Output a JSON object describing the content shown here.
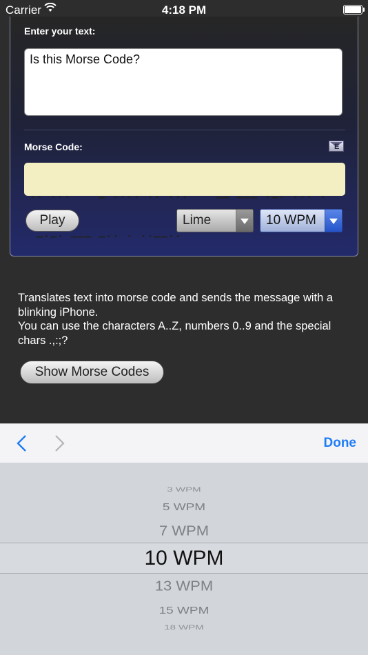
{
  "status_bar": {
    "carrier": "Carrier",
    "time": "4:18 PM"
  },
  "input_section": {
    "label": "Enter your text:",
    "value": "Is this Morse Code?"
  },
  "morse_section": {
    "label": "Morse Code:",
    "mail_icon_letter": "E",
    "code_line1": "·· ···    – ···· ·· ···    –– ––– ·–· ··· ·",
    "code_line2": " –·–· ––– –·· · ··––··"
  },
  "controls": {
    "play_label": "Play",
    "color_select": "Lime",
    "speed_select": "10 WPM"
  },
  "description": {
    "line1": "Translates text into morse code and sends the message with a blinking iPhone.",
    "line2": "You can use the characters A..Z, numbers 0..9 and the special chars .,:;?"
  },
  "show_codes_label": "Show Morse Codes",
  "toolbar": {
    "done_label": "Done"
  },
  "picker": {
    "options": [
      "3 WPM",
      "5 WPM",
      "7 WPM",
      "10 WPM",
      "13 WPM",
      "15 WPM",
      "18 WPM"
    ],
    "selected": "10 WPM"
  },
  "colors": {
    "accent": "#1e7cf5",
    "morse_bg": "#f3efc2"
  }
}
